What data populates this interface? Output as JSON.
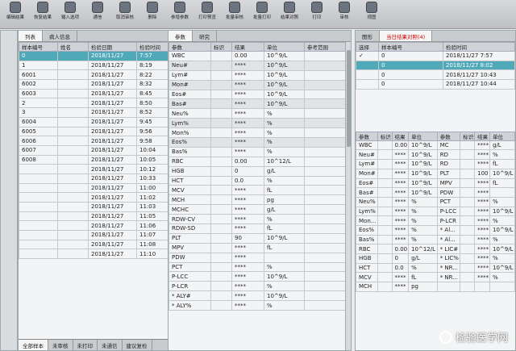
{
  "toolbar": {
    "buttons": [
      "编辑结果",
      "恢复结果",
      "输入选项",
      "通信",
      "取消审核",
      "删除",
      "参增参数",
      "打印预览",
      "批量审核",
      "批量打印",
      "结果对照",
      "打印",
      "审核",
      "视图"
    ]
  },
  "left": {
    "tabs": [
      "列表",
      "病人信息"
    ],
    "headers": [
      "样本编号",
      "姓名",
      "检验日期",
      "检验时间"
    ],
    "rows": [
      {
        "id": "0",
        "name": "",
        "date": "2018/11/27",
        "time": "7:57"
      },
      {
        "id": "1",
        "name": "",
        "date": "2018/11/27",
        "time": "8:19"
      },
      {
        "id": "6001",
        "name": "",
        "date": "2018/11/27",
        "time": "8:22"
      },
      {
        "id": "6002",
        "name": "",
        "date": "2018/11/27",
        "time": "8:32"
      },
      {
        "id": "6003",
        "name": "",
        "date": "2018/11/27",
        "time": "8:45"
      },
      {
        "id": "2",
        "name": "",
        "date": "2018/11/27",
        "time": "8:50"
      },
      {
        "id": "3",
        "name": "",
        "date": "2018/11/27",
        "time": "8:52"
      },
      {
        "id": "6004",
        "name": "",
        "date": "2018/11/27",
        "time": "9:45"
      },
      {
        "id": "6005",
        "name": "",
        "date": "2018/11/27",
        "time": "9:56"
      },
      {
        "id": "6006",
        "name": "",
        "date": "2018/11/27",
        "time": "9:58"
      },
      {
        "id": "6007",
        "name": "",
        "date": "2018/11/27",
        "time": "10:04"
      },
      {
        "id": "6008",
        "name": "",
        "date": "2018/11/27",
        "time": "10:05"
      },
      {
        "id": "",
        "name": "",
        "date": "2018/11/27",
        "time": "10:12"
      },
      {
        "id": "",
        "name": "",
        "date": "2018/11/27",
        "time": "10:33"
      },
      {
        "id": "",
        "name": "",
        "date": "2018/11/27",
        "time": "11:00"
      },
      {
        "id": "",
        "name": "",
        "date": "2018/11/27",
        "time": "11:02"
      },
      {
        "id": "",
        "name": "",
        "date": "2018/11/27",
        "time": "11:03"
      },
      {
        "id": "",
        "name": "",
        "date": "2018/11/27",
        "time": "11:05"
      },
      {
        "id": "",
        "name": "",
        "date": "2018/11/27",
        "time": "11:06"
      },
      {
        "id": "",
        "name": "",
        "date": "2018/11/27",
        "time": "11:07"
      },
      {
        "id": "",
        "name": "",
        "date": "2018/11/27",
        "time": "11:08"
      },
      {
        "id": "",
        "name": "",
        "date": "2018/11/27",
        "time": "11:10"
      }
    ],
    "bottom_tabs": [
      "全部样本",
      "未审核",
      "未打印",
      "未通信",
      "建议复检"
    ]
  },
  "middle": {
    "tabs": [
      "参数",
      "研究"
    ],
    "headers": [
      "参数",
      "标识",
      "结果",
      "单位",
      "参考范围"
    ],
    "rows": [
      {
        "p": "WBC",
        "f": "",
        "r": "0.00",
        "u": "10^9/L",
        "ref": ""
      },
      {
        "p": "Neu#",
        "f": "",
        "r": "****",
        "u": "10^9/L",
        "ref": ""
      },
      {
        "p": "Lym#",
        "f": "",
        "r": "****",
        "u": "10^9/L",
        "ref": ""
      },
      {
        "p": "Mon#",
        "f": "",
        "r": "****",
        "u": "10^9/L",
        "ref": ""
      },
      {
        "p": "Eos#",
        "f": "",
        "r": "****",
        "u": "10^9/L",
        "ref": ""
      },
      {
        "p": "Bas#",
        "f": "",
        "r": "****",
        "u": "10^9/L",
        "ref": ""
      },
      {
        "p": "Neu%",
        "f": "",
        "r": "****",
        "u": "%",
        "ref": ""
      },
      {
        "p": "Lym%",
        "f": "",
        "r": "****",
        "u": "%",
        "ref": ""
      },
      {
        "p": "Mon%",
        "f": "",
        "r": "****",
        "u": "%",
        "ref": ""
      },
      {
        "p": "Eos%",
        "f": "",
        "r": "****",
        "u": "%",
        "ref": ""
      },
      {
        "p": "Bas%",
        "f": "",
        "r": "****",
        "u": "%",
        "ref": ""
      },
      {
        "p": "RBC",
        "f": "",
        "r": "0.00",
        "u": "10^12/L",
        "ref": ""
      },
      {
        "p": "HGB",
        "f": "",
        "r": "0",
        "u": "g/L",
        "ref": ""
      },
      {
        "p": "HCT",
        "f": "",
        "r": "0.0",
        "u": "%",
        "ref": ""
      },
      {
        "p": "MCV",
        "f": "",
        "r": "****",
        "u": "fL",
        "ref": ""
      },
      {
        "p": "MCH",
        "f": "",
        "r": "****",
        "u": "pg",
        "ref": ""
      },
      {
        "p": "MCHC",
        "f": "",
        "r": "****",
        "u": "g/L",
        "ref": ""
      },
      {
        "p": "RDW-CV",
        "f": "",
        "r": "****",
        "u": "%",
        "ref": ""
      },
      {
        "p": "RDW-SD",
        "f": "",
        "r": "****",
        "u": "fL",
        "ref": ""
      },
      {
        "p": "PLT",
        "f": "",
        "r": "90",
        "u": "10^9/L",
        "ref": ""
      },
      {
        "p": "MPV",
        "f": "",
        "r": "****",
        "u": "fL",
        "ref": ""
      },
      {
        "p": "PDW",
        "f": "",
        "r": "****",
        "u": "",
        "ref": ""
      },
      {
        "p": "PCT",
        "f": "",
        "r": "****",
        "u": "%",
        "ref": ""
      },
      {
        "p": "P-LCC",
        "f": "",
        "r": "****",
        "u": "10^9/L",
        "ref": ""
      },
      {
        "p": "P-LCR",
        "f": "",
        "r": "****",
        "u": "%",
        "ref": ""
      },
      {
        "p": "* ALY#",
        "f": "",
        "r": "****",
        "u": "10^9/L",
        "ref": ""
      },
      {
        "p": "* ALY%",
        "f": "",
        "r": "****",
        "u": "%",
        "ref": ""
      }
    ]
  },
  "right": {
    "tabs": [
      "图形",
      "当日结果对照(4)"
    ],
    "top_headers": [
      "选择",
      "样本编号",
      "检验时间"
    ],
    "top_rows": [
      {
        "c": "✓",
        "id": "0",
        "t": "2018/11/27 7:57"
      },
      {
        "c": "",
        "id": "0",
        "t": "2018/11/27 8:02"
      },
      {
        "c": "",
        "id": "0",
        "t": "2018/11/27 10:43"
      },
      {
        "c": "",
        "id": "0",
        "t": "2018/11/27 10:44"
      }
    ],
    "bottom_headers": [
      "参数",
      "标识",
      "结果",
      "单位",
      "参数",
      "标识",
      "结果",
      "单位"
    ],
    "bottom_rows": [
      [
        "WBC",
        "",
        "0.00",
        "10^9/L",
        "MC",
        "",
        "****",
        "g/L"
      ],
      [
        "Neu#",
        "",
        "****",
        "10^9/L",
        "RD",
        "",
        "****",
        "%"
      ],
      [
        "Lym#",
        "",
        "****",
        "10^9/L",
        "RD",
        "",
        "****",
        "fL"
      ],
      [
        "Mon#",
        "",
        "****",
        "10^9/L",
        "PLT",
        "",
        "100",
        "10^9/L"
      ],
      [
        "Eos#",
        "",
        "****",
        "10^9/L",
        "MPV",
        "",
        "****",
        "fL"
      ],
      [
        "Bas#",
        "",
        "****",
        "10^9/L",
        "PDW",
        "",
        "****",
        ""
      ],
      [
        "Neu%",
        "",
        "****",
        "%",
        "PCT",
        "",
        "****",
        "%"
      ],
      [
        "Lym%",
        "",
        "****",
        "%",
        "P-LCC",
        "",
        "****",
        "10^9/L"
      ],
      [
        "Mon...",
        "",
        "****",
        "%",
        "P-LCR",
        "",
        "****",
        "%"
      ],
      [
        "Eos%",
        "",
        "****",
        "%",
        "* Al...",
        "",
        "****",
        "10^9/L"
      ],
      [
        "Bas%",
        "",
        "****",
        "%",
        "* Al...",
        "",
        "****",
        "%"
      ],
      [
        "RBC",
        "",
        "0.00",
        "10^12/L",
        "* LIC#",
        "",
        "****",
        "10^9/L"
      ],
      [
        "HGB",
        "",
        "0",
        "g/L",
        "* LIC%",
        "",
        "****",
        "%"
      ],
      [
        "HCT",
        "",
        "0.0",
        "%",
        "* NR...",
        "",
        "****",
        "10^9/L"
      ],
      [
        "MCV",
        "",
        "****",
        "fL",
        "* NR...",
        "",
        "****",
        "%"
      ],
      [
        "MCH",
        "",
        "****",
        "pg",
        "",
        "",
        "",
        ""
      ]
    ]
  },
  "watermark": "检验医学网"
}
